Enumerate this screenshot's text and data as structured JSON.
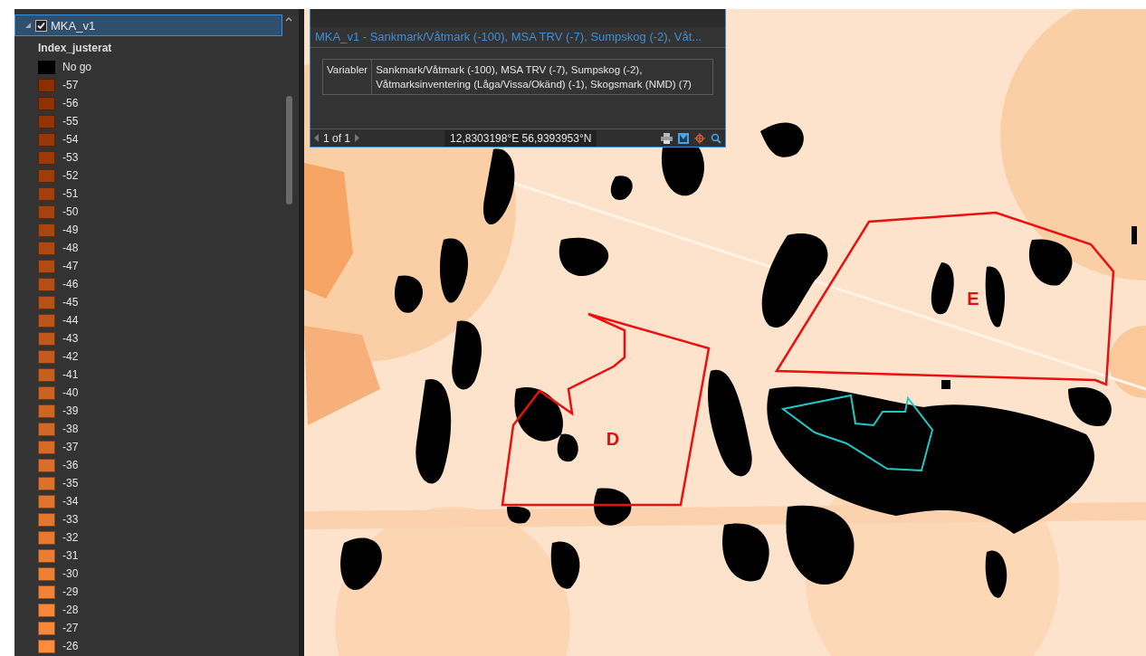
{
  "contents": {
    "layer": {
      "name": "MKA_v1",
      "checked": true,
      "expanded": true,
      "selected": true
    },
    "field": "Index_justerat",
    "legend": [
      {
        "label": "No go",
        "color": "#000000"
      },
      {
        "label": "-57",
        "color": "#8b2e00"
      },
      {
        "label": "-56",
        "color": "#8f3102"
      },
      {
        "label": "-55",
        "color": "#923404"
      },
      {
        "label": "-54",
        "color": "#963706"
      },
      {
        "label": "-53",
        "color": "#9a3a08"
      },
      {
        "label": "-52",
        "color": "#9d3d0a"
      },
      {
        "label": "-51",
        "color": "#a1400c"
      },
      {
        "label": "-50",
        "color": "#a5430e"
      },
      {
        "label": "-49",
        "color": "#a8460f"
      },
      {
        "label": "-48",
        "color": "#ac4911"
      },
      {
        "label": "-47",
        "color": "#b04c13"
      },
      {
        "label": "-46",
        "color": "#b34f15"
      },
      {
        "label": "-45",
        "color": "#b75217"
      },
      {
        "label": "-44",
        "color": "#bb5519"
      },
      {
        "label": "-43",
        "color": "#be581b"
      },
      {
        "label": "-42",
        "color": "#c25b1d"
      },
      {
        "label": "-41",
        "color": "#c65e1f"
      },
      {
        "label": "-40",
        "color": "#ca6221"
      },
      {
        "label": "-39",
        "color": "#cd6523"
      },
      {
        "label": "-38",
        "color": "#d16825"
      },
      {
        "label": "-37",
        "color": "#d56b27"
      },
      {
        "label": "-36",
        "color": "#d86e29"
      },
      {
        "label": "-35",
        "color": "#dc712b"
      },
      {
        "label": "-34",
        "color": "#e0742d"
      },
      {
        "label": "-33",
        "color": "#e3772e"
      },
      {
        "label": "-32",
        "color": "#e77a30"
      },
      {
        "label": "-31",
        "color": "#eb7d32"
      },
      {
        "label": "-30",
        "color": "#ee8034"
      },
      {
        "label": "-29",
        "color": "#f28336"
      },
      {
        "label": "-28",
        "color": "#f68638"
      },
      {
        "label": "-27",
        "color": "#f9893a"
      },
      {
        "label": "-26",
        "color": "#fd8c3c"
      }
    ]
  },
  "popup": {
    "title": "MKA_v1 - Sankmark/Våtmark (-100), MSA TRV (-7), Sumpskog (-2), Våt...",
    "attributes": [
      {
        "field": "Variabler",
        "value": "Sankmark/Våtmark (-100), MSA TRV (-7), Sumpskog (-2), Våtmarksinventering (Låga/Vissa/Okänd) (-1), Skogsmark (NMD) (7)"
      }
    ],
    "pager": "1 of 1",
    "coordinates": "12,8303198°E 56,9393953°N"
  },
  "map": {
    "labels": [
      "D",
      "E"
    ]
  }
}
